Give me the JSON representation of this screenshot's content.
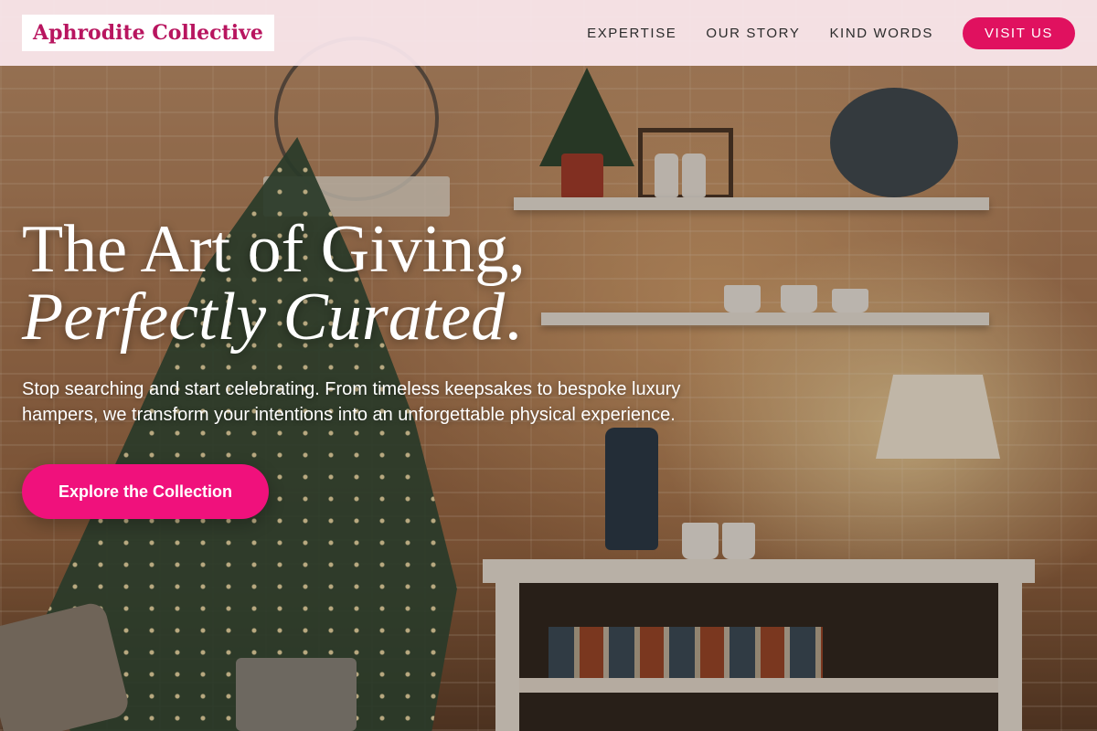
{
  "header": {
    "logo": "Aphrodite Collective",
    "nav": [
      {
        "label": "EXPERTISE"
      },
      {
        "label": "OUR STORY"
      },
      {
        "label": "KIND WORDS"
      }
    ],
    "cta_label": "VISIT US"
  },
  "hero": {
    "headline_line1": "The Art of Giving,",
    "headline_line2": "Perfectly Curated",
    "headline_period": ".",
    "subtext": "Stop searching and start celebrating. From timeless keepsakes to bespoke luxury hampers, we transform your intentions into an unforgettable physical experience.",
    "cta_label": "Explore the Collection"
  },
  "colors": {
    "brand": "#b8155f",
    "accent": "#e0115f",
    "cta": "#f0117c",
    "header_bg": "#fce9f0"
  }
}
